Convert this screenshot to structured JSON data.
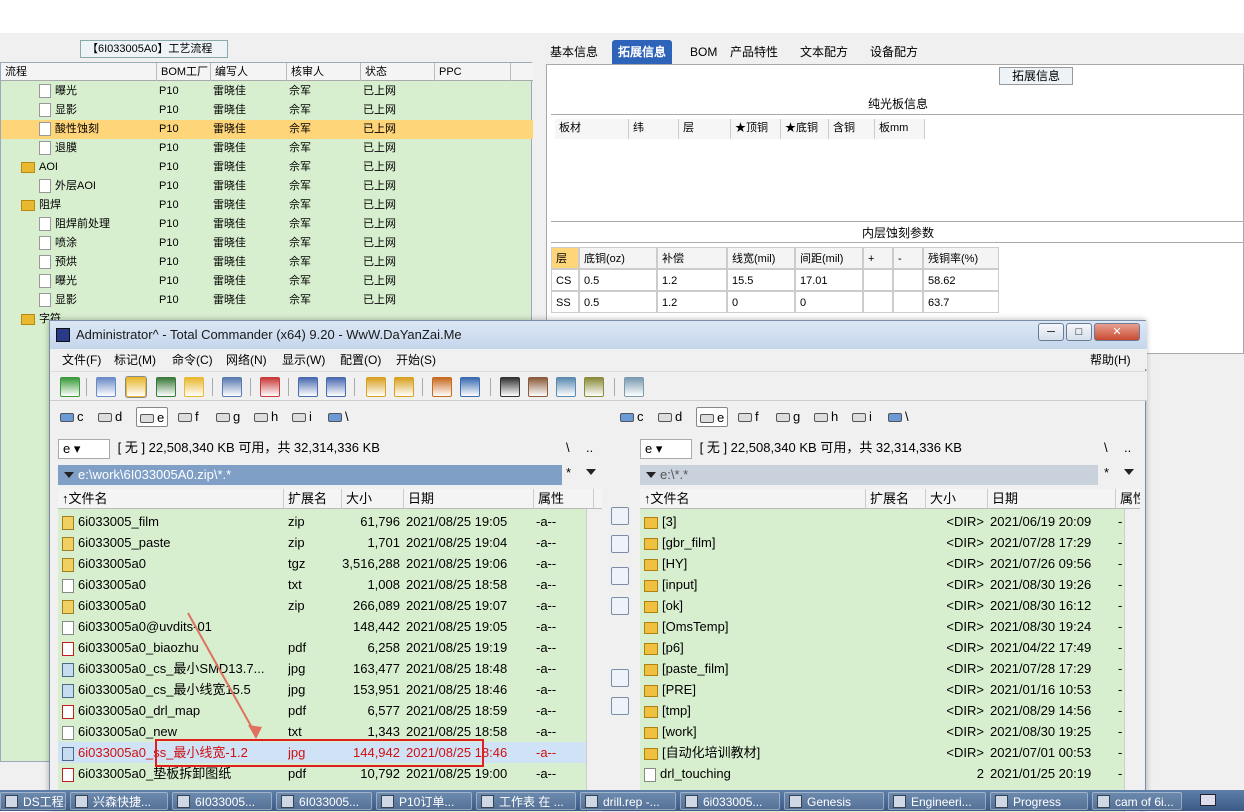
{
  "left_panel": {
    "title": "【6I033005A0】工艺流程",
    "columns": [
      "流程",
      "BOM工厂",
      "编写人",
      "核审人",
      "状态",
      "PPC"
    ],
    "rows": [
      {
        "indent": 2,
        "name": "曝光",
        "factory": "P10",
        "writer": "雷晓佳",
        "reviewer": "佘军",
        "status": "已上网"
      },
      {
        "indent": 2,
        "name": "显影",
        "factory": "P10",
        "writer": "雷晓佳",
        "reviewer": "佘军",
        "status": "已上网"
      },
      {
        "indent": 2,
        "name": "酸性蚀刻",
        "factory": "P10",
        "writer": "雷晓佳",
        "reviewer": "佘军",
        "status": "已上网",
        "selected": true
      },
      {
        "indent": 2,
        "name": "退膜",
        "factory": "P10",
        "writer": "雷晓佳",
        "reviewer": "佘军",
        "status": "已上网"
      },
      {
        "indent": 1,
        "name": "AOI",
        "factory": "P10",
        "writer": "雷晓佳",
        "reviewer": "佘军",
        "status": "已上网",
        "folder": true
      },
      {
        "indent": 2,
        "name": "外层AOI",
        "factory": "P10",
        "writer": "雷晓佳",
        "reviewer": "佘军",
        "status": "已上网"
      },
      {
        "indent": 1,
        "name": "阻焊",
        "factory": "P10",
        "writer": "雷晓佳",
        "reviewer": "佘军",
        "status": "已上网",
        "folder": true
      },
      {
        "indent": 2,
        "name": "阻焊前处理",
        "factory": "P10",
        "writer": "雷晓佳",
        "reviewer": "佘军",
        "status": "已上网"
      },
      {
        "indent": 2,
        "name": "喷涂",
        "factory": "P10",
        "writer": "雷晓佳",
        "reviewer": "佘军",
        "status": "已上网"
      },
      {
        "indent": 2,
        "name": "预烘",
        "factory": "P10",
        "writer": "雷晓佳",
        "reviewer": "佘军",
        "status": "已上网"
      },
      {
        "indent": 2,
        "name": "曝光",
        "factory": "P10",
        "writer": "雷晓佳",
        "reviewer": "佘军",
        "status": "已上网"
      },
      {
        "indent": 2,
        "name": "显影",
        "factory": "P10",
        "writer": "雷晓佳",
        "reviewer": "佘军",
        "status": "已上网"
      },
      {
        "indent": 1,
        "name": "字符",
        "factory": "",
        "writer": "",
        "reviewer": "",
        "status": "",
        "folder": true
      }
    ]
  },
  "right_app": {
    "tabs": [
      "基本信息",
      "拓展信息",
      "BOM",
      "产品特性",
      "文本配方",
      "设备配方"
    ],
    "active_tab": "拓展信息",
    "panel_title": "拓展信息",
    "section1_title": "纯光板信息",
    "section1_headers": [
      "板材",
      "纬",
      "层",
      "★顶铜",
      "★底铜",
      "含铜",
      "板mm"
    ],
    "section2_title": "内层蚀刻参数",
    "section2_headers": [
      "层",
      "底铜(oz)",
      "补偿",
      "线宽(mil)",
      "间距(mil)",
      "+",
      "-",
      "残铜率(%)"
    ],
    "section2_rows": [
      [
        "CS",
        "0.5",
        "1.2",
        "15.5",
        "17.01",
        "",
        "",
        "58.62"
      ],
      [
        "SS",
        "0.5",
        "1.2",
        "0",
        "0",
        "",
        "",
        "63.7"
      ]
    ]
  },
  "total_commander": {
    "title": "Administrator^ - Total Commander (x64) 9.20 - WwW.DaYanZai.Me",
    "window_buttons": [
      "─",
      "□",
      "✕"
    ],
    "menu": [
      "文件(F)",
      "标记(M)",
      "命令(C)",
      "网络(N)",
      "显示(W)",
      "配置(O)",
      "开始(S)"
    ],
    "help": "帮助(H)",
    "drives": [
      "c",
      "d",
      "e",
      "f",
      "g",
      "h",
      "i",
      "\\"
    ],
    "left": {
      "drive": "e",
      "info": "[ 无 ]  22,508,340 KB 可用，共 32,314,336 KB",
      "root_btn": "\\",
      "up_btn": "..",
      "path": "e:\\work\\6I033005A0.zip\\*.*",
      "path_star": "*",
      "columns": [
        "↑文件名",
        "扩展名",
        "大小",
        "日期",
        "属性"
      ],
      "files": [
        {
          "icon": "zip",
          "name": "6i033005_film",
          "ext": "zip",
          "size": "61,796",
          "date": "2021/08/25 19:05",
          "attr": "-a--"
        },
        {
          "icon": "zip",
          "name": "6i033005_paste",
          "ext": "zip",
          "size": "1,701",
          "date": "2021/08/25 19:04",
          "attr": "-a--"
        },
        {
          "icon": "zip",
          "name": "6i033005a0",
          "ext": "tgz",
          "size": "3,516,288",
          "date": "2021/08/25 19:06",
          "attr": "-a--"
        },
        {
          "icon": "txt",
          "name": "6i033005a0",
          "ext": "txt",
          "size": "1,008",
          "date": "2021/08/25 18:58",
          "attr": "-a--"
        },
        {
          "icon": "zip",
          "name": "6i033005a0",
          "ext": "zip",
          "size": "266,089",
          "date": "2021/08/25 19:07",
          "attr": "-a--"
        },
        {
          "icon": "txt",
          "name": "6i033005a0@uvdits-01",
          "ext": "",
          "size": "148,442",
          "date": "2021/08/25 19:05",
          "attr": "-a--"
        },
        {
          "icon": "pdf",
          "name": "6i033005a0_biaozhu",
          "ext": "pdf",
          "size": "6,258",
          "date": "2021/08/25 19:19",
          "attr": "-a--"
        },
        {
          "icon": "jpg",
          "name": "6i033005a0_cs_最小SMD13.7...",
          "ext": "jpg",
          "size": "163,477",
          "date": "2021/08/25 18:48",
          "attr": "-a--"
        },
        {
          "icon": "jpg",
          "name": "6i033005a0_cs_最小线宽15.5",
          "ext": "jpg",
          "size": "153,951",
          "date": "2021/08/25 18:46",
          "attr": "-a--"
        },
        {
          "icon": "pdf",
          "name": "6i033005a0_drl_map",
          "ext": "pdf",
          "size": "6,577",
          "date": "2021/08/25 18:59",
          "attr": "-a--"
        },
        {
          "icon": "txt",
          "name": "6i033005a0_new",
          "ext": "txt",
          "size": "1,343",
          "date": "2021/08/25 18:58",
          "attr": "-a--"
        },
        {
          "icon": "jpg",
          "name": "6i033005a0_ss_最小线宽-1.2",
          "ext": "jpg",
          "size": "144,942",
          "date": "2021/08/25 18:46",
          "attr": "-a--",
          "highlight": true
        },
        {
          "icon": "pdf",
          "name": "6i033005a0_垫板拆卸图纸",
          "ext": "pdf",
          "size": "10,792",
          "date": "2021/08/25 19:00",
          "attr": "-a--"
        }
      ]
    },
    "right": {
      "drive": "e",
      "info": "[ 无 ]  22,508,340 KB 可用，共 32,314,336 KB",
      "root_btn": "\\",
      "up_btn": "..",
      "path": "e:\\*.*",
      "path_star": "*",
      "columns": [
        "↑文件名",
        "扩展名",
        "大小",
        "日期",
        "属性"
      ],
      "files": [
        {
          "icon": "dir",
          "name": "[3]",
          "ext": "",
          "size": "<DIR>",
          "date": "2021/06/19 20:09",
          "attr": "-"
        },
        {
          "icon": "dir",
          "name": "[gbr_film]",
          "ext": "",
          "size": "<DIR>",
          "date": "2021/07/28 17:29",
          "attr": "-"
        },
        {
          "icon": "dir",
          "name": "[HY]",
          "ext": "",
          "size": "<DIR>",
          "date": "2021/07/26 09:56",
          "attr": "-"
        },
        {
          "icon": "dir",
          "name": "[input]",
          "ext": "",
          "size": "<DIR>",
          "date": "2021/08/30 19:26",
          "attr": "-"
        },
        {
          "icon": "dir",
          "name": "[ok]",
          "ext": "",
          "size": "<DIR>",
          "date": "2021/08/30 16:12",
          "attr": "-"
        },
        {
          "icon": "dir",
          "name": "[OmsTemp]",
          "ext": "",
          "size": "<DIR>",
          "date": "2021/08/30 19:24",
          "attr": "-"
        },
        {
          "icon": "dir",
          "name": "[p6]",
          "ext": "",
          "size": "<DIR>",
          "date": "2021/04/22 17:49",
          "attr": "-"
        },
        {
          "icon": "dir",
          "name": "[paste_film]",
          "ext": "",
          "size": "<DIR>",
          "date": "2021/07/28 17:29",
          "attr": "-"
        },
        {
          "icon": "dir",
          "name": "[PRE]",
          "ext": "",
          "size": "<DIR>",
          "date": "2021/01/16 10:53",
          "attr": "-"
        },
        {
          "icon": "dir",
          "name": "[tmp]",
          "ext": "",
          "size": "<DIR>",
          "date": "2021/08/29 14:56",
          "attr": "-"
        },
        {
          "icon": "dir",
          "name": "[work]",
          "ext": "",
          "size": "<DIR>",
          "date": "2021/08/30 19:25",
          "attr": "-"
        },
        {
          "icon": "dir",
          "name": "[自动化培训教材]",
          "ext": "",
          "size": "<DIR>",
          "date": "2021/07/01 00:53",
          "attr": "-"
        },
        {
          "icon": "txt",
          "name": "drl_touching",
          "ext": "",
          "size": "2",
          "date": "2021/01/25 20:19",
          "attr": "-"
        }
      ]
    }
  },
  "taskbar": [
    "DS工程...",
    "兴森快捷...",
    "6I033005...",
    "6I033005...",
    "P10订单...",
    "工作表 在 ...",
    "drill.rep -...",
    "6i033005...",
    "Genesis",
    "Engineeri...",
    "Progress",
    "cam of 6i..."
  ],
  "colors": {
    "highlight_red": "#d01010",
    "annotation_red": "#e02020",
    "panel_green": "#d8efcf",
    "selected_orange": "#ffd57a"
  }
}
